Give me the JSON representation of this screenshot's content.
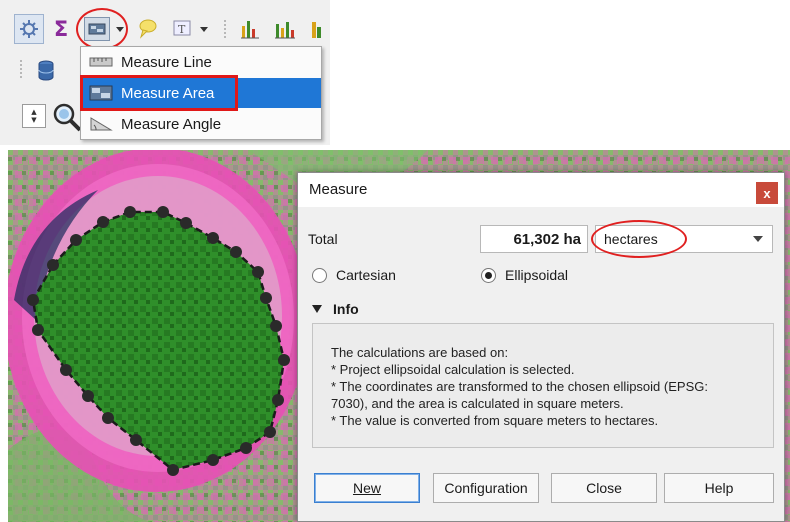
{
  "menu": {
    "items": [
      {
        "label": "Measure Line",
        "icon": "ruler-icon"
      },
      {
        "label": "Measure Area",
        "icon": "area-icon",
        "selected": true
      },
      {
        "label": "Measure Angle",
        "icon": "angle-icon"
      }
    ]
  },
  "toolbar": {
    "icons": [
      "cog-icon",
      "sigma-icon",
      "measure-tool-icon",
      "dropdown-arrow-icon",
      "tooltip-icon",
      "text-annotation-icon",
      "chart-icon",
      "chart-icon",
      "chart-icon",
      "database-icon",
      "spinbox-icon",
      "zoom-icon"
    ],
    "highlight_color": "#e02020"
  },
  "dialog": {
    "title": "Measure",
    "close_symbol": "x",
    "total_label": "Total",
    "total_value": "61,302 ha",
    "unit": "hectares",
    "radio_cartesian": "Cartesian",
    "radio_ellipsoidal": "Ellipsoidal",
    "selected_mode": "Ellipsoidal",
    "info_header": "Info",
    "info_lines": [
      "The calculations are based on:",
      "* Project ellipsoidal calculation is selected.",
      "* The coordinates are transformed to the chosen ellipsoid (EPSG:",
      "7030), and the area is calculated in square meters.",
      "* The value is converted from square meters to hectares."
    ],
    "buttons": {
      "new": "New",
      "configuration": "Configuration",
      "close": "Close",
      "help": "Help"
    }
  },
  "colors": {
    "selection": "#1f77d6",
    "annotation_red": "#e01818",
    "vegetation_green": "#2f9a2a",
    "magenta": "#d83aa6"
  }
}
